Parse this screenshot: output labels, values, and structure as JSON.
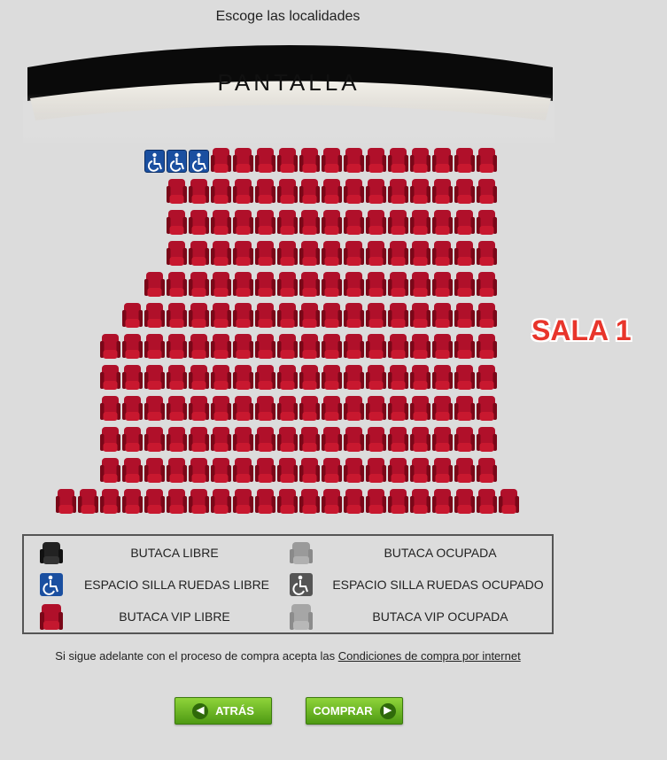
{
  "header": {
    "title": "Escoge las localidades"
  },
  "screen": {
    "label": "PANTALLA"
  },
  "room": {
    "name": "SALA 1"
  },
  "seatmap": {
    "rows": [
      {
        "start": 7,
        "end": 22,
        "wheelchair": [
          7,
          8,
          9
        ]
      },
      {
        "start": 8,
        "end": 22,
        "wheelchair": []
      },
      {
        "start": 8,
        "end": 22,
        "wheelchair": []
      },
      {
        "start": 8,
        "end": 22,
        "wheelchair": []
      },
      {
        "start": 7,
        "end": 22,
        "wheelchair": []
      },
      {
        "start": 6,
        "end": 22,
        "wheelchair": []
      },
      {
        "start": 5,
        "end": 22,
        "wheelchair": []
      },
      {
        "start": 5,
        "end": 22,
        "wheelchair": []
      },
      {
        "start": 5,
        "end": 22,
        "wheelchair": []
      },
      {
        "start": 5,
        "end": 22,
        "wheelchair": []
      },
      {
        "start": 5,
        "end": 22,
        "wheelchair": []
      },
      {
        "start": 3,
        "end": 23,
        "wheelchair": []
      }
    ],
    "colors": {
      "vip": "#b0102a",
      "vip_dark": "#7a0718",
      "wheelchair": "#1a4fa0"
    }
  },
  "legend": {
    "items": [
      {
        "label": "BUTACA LIBRE",
        "icon": "black-seat-icon"
      },
      {
        "label": "BUTACA OCUPADA",
        "icon": "grey-seat-icon"
      },
      {
        "label": "ESPACIO SILLA RUEDAS LIBRE",
        "icon": "wheelchair-free-icon"
      },
      {
        "label": "ESPACIO SILLA RUEDAS OCUPADO",
        "icon": "wheelchair-occupied-icon"
      },
      {
        "label": "BUTACA VIP LIBRE",
        "icon": "vip-seat-icon"
      },
      {
        "label": "BUTACA VIP OCUPADA",
        "icon": "vip-seat-occupied-icon"
      }
    ]
  },
  "notice": {
    "text": "Si sigue adelante con el proceso de compra acepta las",
    "link": "Condiciones de compra por internet"
  },
  "buttons": {
    "back": "ATRÁS",
    "buy": "COMPRAR"
  }
}
